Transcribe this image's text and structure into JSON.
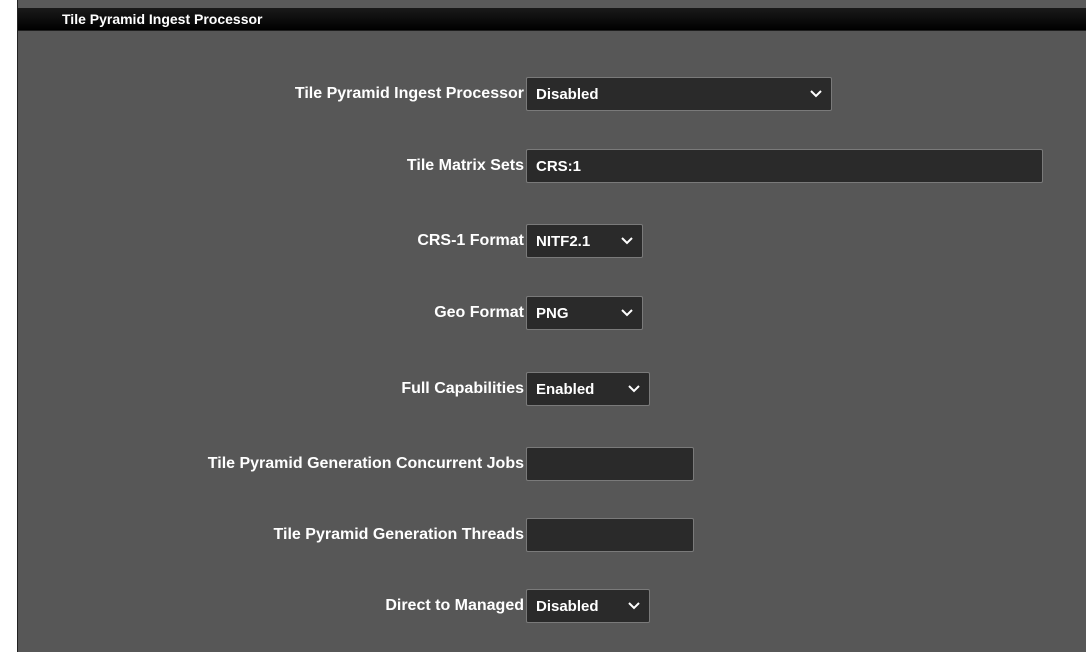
{
  "panel": {
    "title": "Tile Pyramid Ingest Processor"
  },
  "fields": {
    "processor": {
      "label": "Tile Pyramid Ingest Processor",
      "value": "Disabled"
    },
    "tile_matrix_sets": {
      "label": "Tile Matrix Sets",
      "value": "CRS:1"
    },
    "crs1_format": {
      "label": "CRS-1 Format",
      "value": "NITF2.1"
    },
    "geo_format": {
      "label": "Geo Format",
      "value": "PNG"
    },
    "full_capabilities": {
      "label": "Full Capabilities",
      "value": "Enabled"
    },
    "concurrent_jobs": {
      "label": "Tile Pyramid Generation Concurrent Jobs",
      "value": ""
    },
    "threads": {
      "label": "Tile Pyramid Generation Threads",
      "value": ""
    },
    "direct_to_managed": {
      "label": "Direct to Managed",
      "value": "Disabled"
    }
  },
  "icons": {
    "dropdown": "chevron-down-icon"
  },
  "colors": {
    "panel_bg": "#575757",
    "header_bg": "#000000",
    "control_bg": "#2a2a2a",
    "text": "#ffffff"
  }
}
